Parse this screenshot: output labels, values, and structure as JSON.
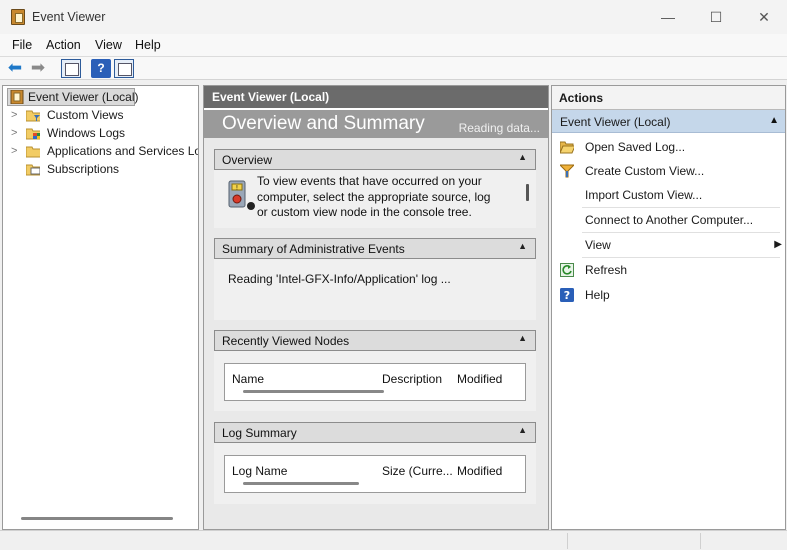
{
  "window": {
    "title": "Event Viewer",
    "minimize_glyph": "—",
    "maximize_glyph": "☐",
    "close_glyph": "✕"
  },
  "menu": [
    "File",
    "Action",
    "View",
    "Help"
  ],
  "toolbar": {
    "back_icon": "back-arrow-icon",
    "forward_icon": "forward-arrow-icon",
    "help_glyph": "?"
  },
  "tree": {
    "root": "Event Viewer (Local)",
    "items": [
      {
        "label": "Custom Views",
        "icon": "folder-filter-icon",
        "expandable": true
      },
      {
        "label": "Windows Logs",
        "icon": "folder-logs-icon",
        "expandable": true
      },
      {
        "label": "Applications and Services Logs",
        "icon": "folder-icon",
        "expandable": true
      },
      {
        "label": "Subscriptions",
        "icon": "subscriptions-icon",
        "expandable": false
      }
    ]
  },
  "middle": {
    "header": "Event Viewer (Local)",
    "banner_title": "Overview and Summary",
    "banner_status": "Reading data...",
    "overview": {
      "title": "Overview",
      "text_line1": "To view events that have occurred on your",
      "text_line2": "computer, select the appropriate source, log",
      "text_line3": "or custom view node in the console tree."
    },
    "summary": {
      "title": "Summary of Administrative Events",
      "text": "Reading 'Intel-GFX-Info/Application' log ..."
    },
    "recent": {
      "title": "Recently Viewed Nodes",
      "columns": [
        "Name",
        "Description",
        "Modified"
      ]
    },
    "log_summary": {
      "title": "Log Summary",
      "columns": [
        "Log Name",
        "Size (Curre...",
        "Modified"
      ]
    },
    "caret_glyph": "▲"
  },
  "actions": {
    "title": "Actions",
    "group": "Event Viewer (Local)",
    "group_caret": "▲",
    "submenu_glyph": "▶",
    "items": [
      {
        "label": "Open Saved Log...",
        "icon": "open-folder-icon"
      },
      {
        "label": "Create Custom View...",
        "icon": "filter-icon"
      },
      {
        "label": "Import Custom View...",
        "icon": ""
      },
      {
        "label": "Connect to Another Computer...",
        "icon": ""
      },
      {
        "label": "View",
        "icon": ""
      },
      {
        "label": "Refresh",
        "icon": "refresh-icon"
      },
      {
        "label": "Help",
        "icon": "help-icon"
      }
    ]
  },
  "colors": {
    "middle_header": "#6b6b6b",
    "banner": "#9a9a9a",
    "actions_group": "#c5d7ea",
    "back_arrow": "#1e78c8"
  }
}
